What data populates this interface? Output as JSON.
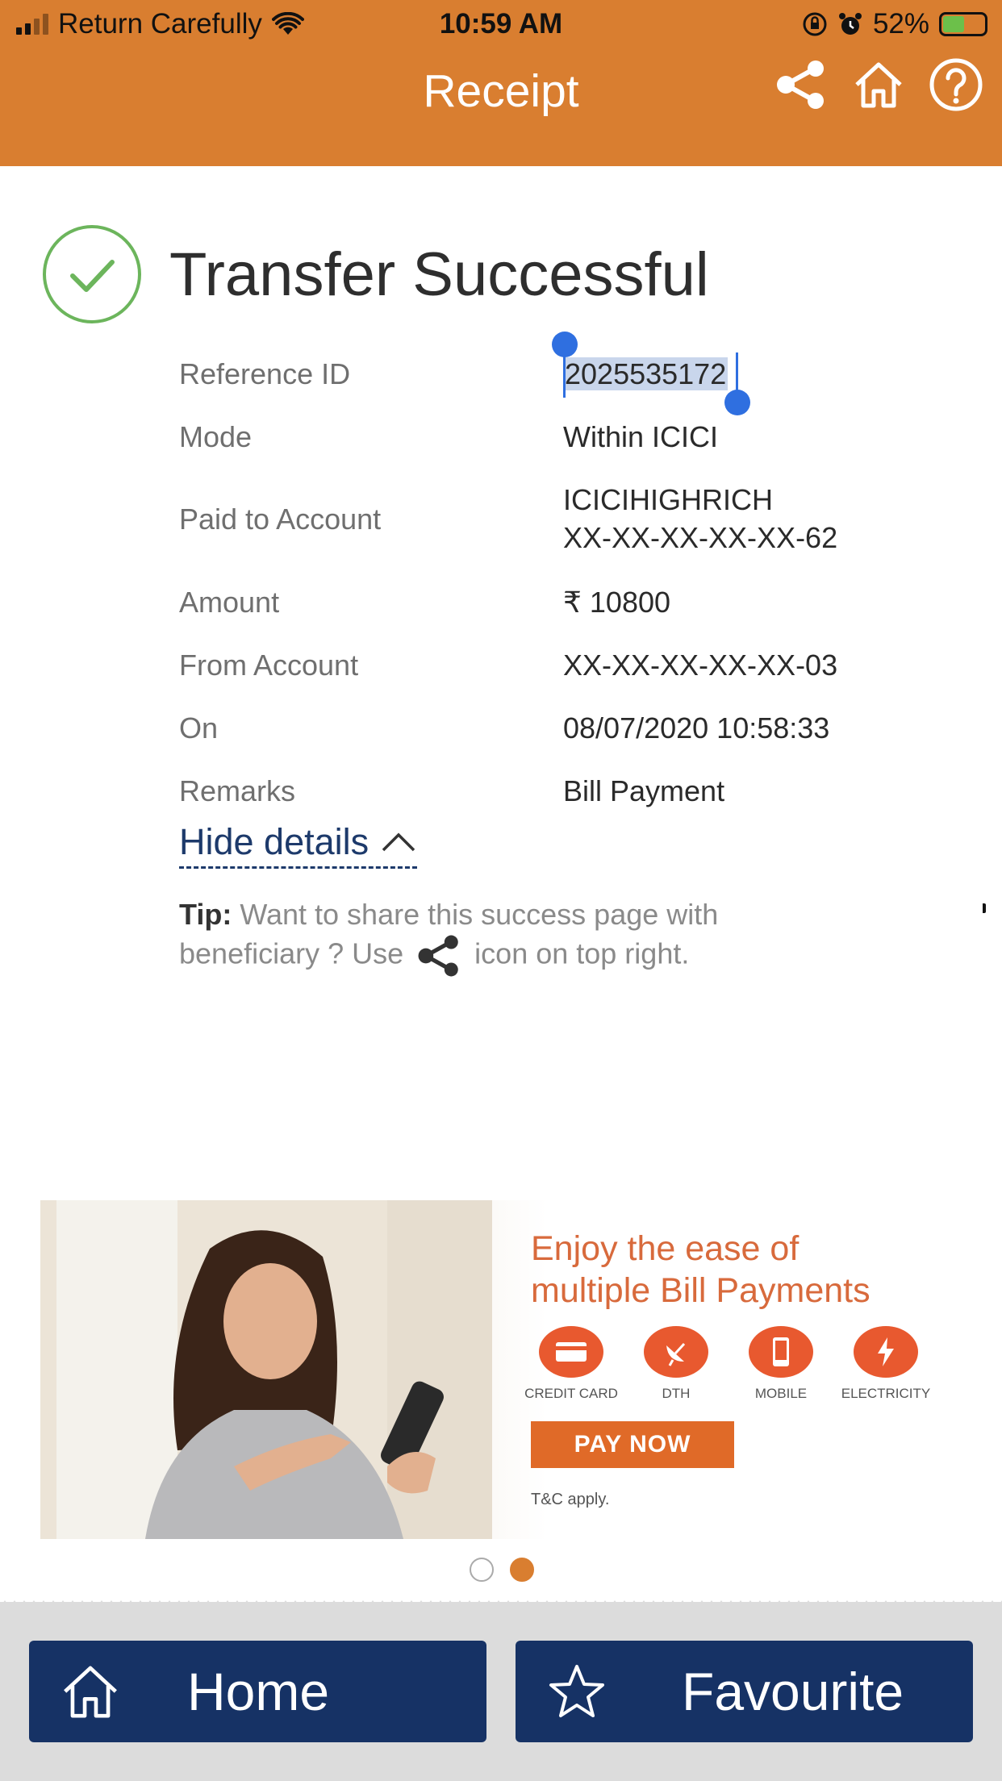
{
  "status_bar": {
    "carrier": "Return Carefully",
    "time": "10:59 AM",
    "battery": "52%",
    "icons": [
      "signal-icon",
      "wifi-icon",
      "orientation-lock-icon",
      "alarm-icon",
      "battery-icon"
    ]
  },
  "header": {
    "title": "Receipt",
    "icons": [
      "share-icon",
      "home-icon",
      "help-icon"
    ],
    "color": "#d97e30"
  },
  "result": {
    "title": "Transfer Successful",
    "status_color": "#6cb55c"
  },
  "details": {
    "reference_label": "Reference ID",
    "reference_value": "2025535172",
    "mode_label": "Mode",
    "mode_value": "Within ICICI",
    "paid_to_label": "Paid to Account",
    "paid_to_name": "ICICIHIGHRICH",
    "paid_to_account": "XX-XX-XX-XX-XX-62",
    "amount_label": "Amount",
    "amount_value": "₹ 10800",
    "from_label": "From Account",
    "from_value": "XX-XX-XX-XX-XX-03",
    "on_label": "On",
    "on_value": "08/07/2020 10:58:33",
    "remarks_label": "Remarks",
    "remarks_value": "Bill Payment"
  },
  "hide_details": "Hide details",
  "tip": {
    "label": "Tip:",
    "text_before": "Want to share this success page with beneficiary ? Use",
    "text_after": "icon on top right."
  },
  "banner": {
    "line1": "Enjoy the ease of",
    "line2": "multiple Bill Payments",
    "items": [
      {
        "label": "CREDIT CARD",
        "icon": "credit-card-icon"
      },
      {
        "label": "DTH",
        "icon": "satellite-dish-icon"
      },
      {
        "label": "MOBILE",
        "icon": "mobile-icon"
      },
      {
        "label": "ELECTRICITY",
        "icon": "lightning-icon"
      }
    ],
    "cta": "PAY NOW",
    "tnc": "T&C apply.",
    "accent": "#e06a28"
  },
  "carousel": {
    "count": 2,
    "active_index": 1
  },
  "bottom_bar": {
    "home_label": "Home",
    "favourite_label": "Favourite",
    "button_color": "#163265"
  }
}
